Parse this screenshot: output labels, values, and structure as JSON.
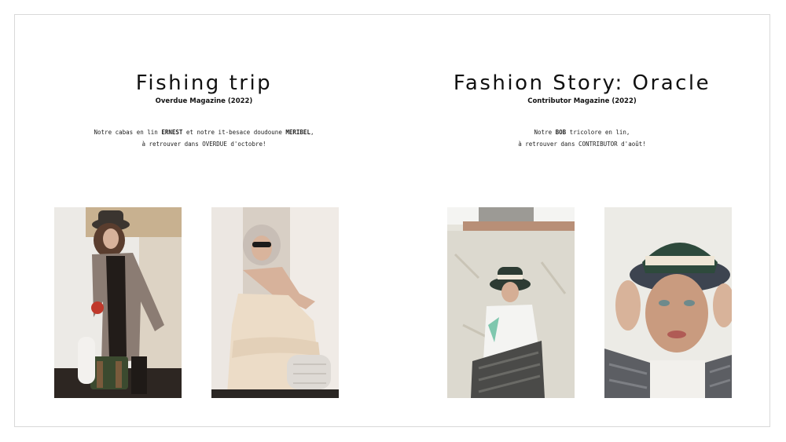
{
  "stories": [
    {
      "title": "Fishing trip",
      "subtitle": "Overdue Magazine (2022)",
      "caption": {
        "l1_a": "Notre cabas en lin ",
        "l1_b": "ERNEST",
        "l1_c": " et notre it-besace doudoune ",
        "l1_d": "MERIBEL",
        "l1_e": ",",
        "l2": "à retrouver dans OVERDUE d'octobre!"
      }
    },
    {
      "title": "Fashion Story: Oracle",
      "subtitle": "Contributor Magazine (2022)",
      "caption": {
        "l1_a": "Notre ",
        "l1_b": "BOB",
        "l1_c": " tricolore en lin,",
        "l2": "à retrouver dans CONTRIBUTOR d'août!"
      }
    }
  ],
  "colors": {
    "frame_border": "#d9d9d9",
    "text": "#111111"
  }
}
